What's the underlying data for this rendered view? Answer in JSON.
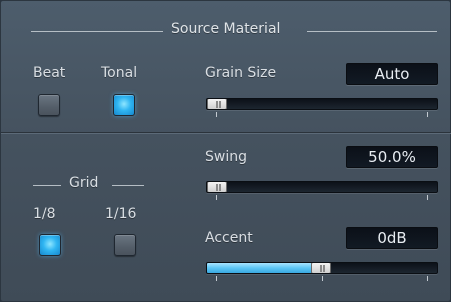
{
  "section_title": "Source Material",
  "mode": {
    "beat_label": "Beat",
    "beat_active": false,
    "tonal_label": "Tonal",
    "tonal_active": true
  },
  "grain_size": {
    "label": "Grain Size",
    "value": "Auto",
    "slider_fraction": 0.0
  },
  "grid": {
    "label": "Grid",
    "options": [
      {
        "label": "1/8",
        "active": true
      },
      {
        "label": "1/16",
        "active": false
      }
    ]
  },
  "swing": {
    "label": "Swing",
    "value": "50.0%",
    "slider_fraction": 0.0
  },
  "accent": {
    "label": "Accent",
    "value": "0dB",
    "slider_fraction": 0.5
  },
  "colors": {
    "accent_blue": "#2fb5f2",
    "panel": "#45525f",
    "display_bg": "#0b1018"
  }
}
